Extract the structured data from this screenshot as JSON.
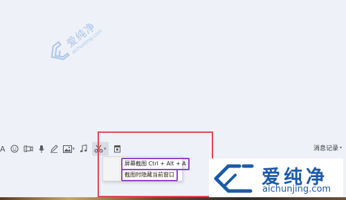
{
  "watermark": {
    "name_cn": "爱纯净",
    "url": "aichunjing.com"
  },
  "toolbar": {
    "font_label": "A",
    "tools": [
      {
        "name": "font-icon"
      },
      {
        "name": "emoji-icon"
      },
      {
        "name": "video-icon"
      },
      {
        "name": "mic-icon"
      },
      {
        "name": "pen-icon"
      },
      {
        "name": "image-icon"
      },
      {
        "name": "music-icon"
      },
      {
        "name": "scissors-icon"
      },
      {
        "name": "shake-icon"
      }
    ],
    "message_record_label": "消息记录"
  },
  "screenshot_menu": {
    "items": [
      {
        "label": "屏幕截图 Ctrl + Alt + A"
      },
      {
        "label": "截图时隐藏当前窗口"
      }
    ]
  },
  "colors": {
    "highlight_red": "#e0474f",
    "menu_outline_purple": "#8e44c7",
    "brand_blue": "#1b5aa8"
  }
}
